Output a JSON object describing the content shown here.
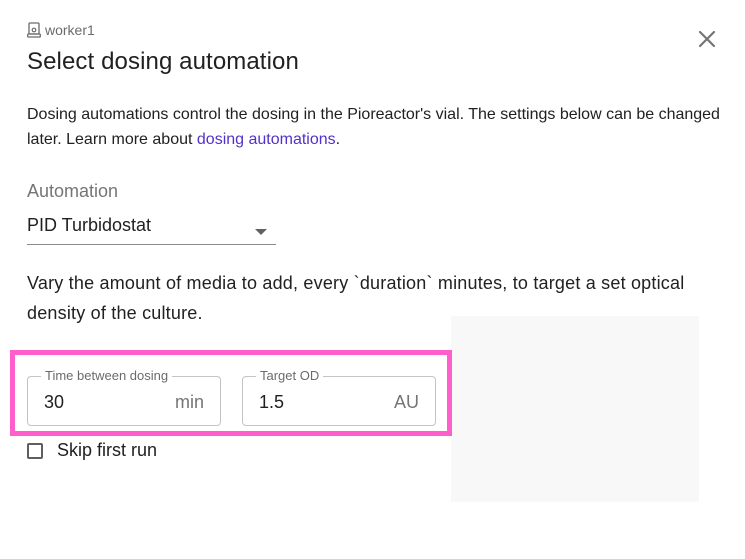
{
  "dialog": {
    "unit_name": "worker1",
    "title": "Select dosing automation",
    "description_prefix": "Dosing automations control the dosing in the Pioreactor's vial. The settings below can be changed later. Learn more about ",
    "description_link": "dosing automations",
    "description_suffix": "."
  },
  "automation": {
    "label": "Automation",
    "selected": "PID Turbidostat",
    "explanation": "Vary the amount of media to add, every `duration` minutes, to target a set optical density of the culture."
  },
  "fields": [
    {
      "label": "Time between dosing",
      "value": "30",
      "unit": "min"
    },
    {
      "label": "Target OD",
      "value": "1.5",
      "unit": "AU"
    }
  ],
  "skip_first_run": {
    "label": "Skip first run",
    "checked": false
  },
  "colors": {
    "link": "#5331ca",
    "highlight": "#ff5fcb"
  },
  "icons": {
    "unit": "pioreactor-icon",
    "close": "close-icon",
    "dropdown": "caret-down-icon"
  }
}
